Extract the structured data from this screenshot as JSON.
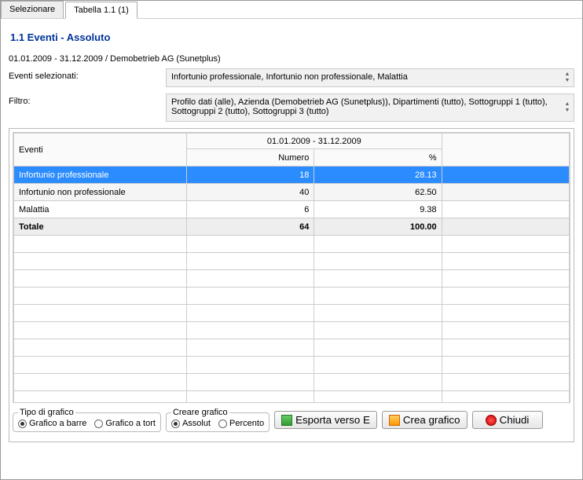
{
  "tabs": {
    "select": "Selezionare",
    "table": "Tabella 1.1 (1)"
  },
  "title": "1.1 Eventi - Assoluto",
  "date_range_company": "01.01.2009 - 31.12.2009 / Demobetrieb AG (Sunetplus)",
  "events_label": "Eventi selezionati:",
  "events_value": "Infortunio professionale, Infortunio non professionale, Malattia",
  "filter_label": "Filtro:",
  "filter_value": "Profilo dati (alle), Azienda (Demobetrieb AG (Sunetplus)), Dipartimenti (tutto), Sottogruppi 1 (tutto), Sottogruppi 2 (tutto), Sottogruppi 3 (tutto)",
  "table": {
    "header_events": "Eventi",
    "header_date_range": "01.01.2009 - 31.12.2009",
    "header_number": "Numero",
    "header_percent": "%",
    "rows": [
      {
        "label": "Infortunio professionale",
        "number": "18",
        "percent": "28.13"
      },
      {
        "label": "Infortunio non professionale",
        "number": "40",
        "percent": "62.50"
      },
      {
        "label": "Malattia",
        "number": "6",
        "percent": "9.38"
      }
    ],
    "total_label": "Totale",
    "total_number": "64",
    "total_percent": "100.00"
  },
  "chart_data": {
    "type": "table",
    "title": "1.1 Eventi - Assoluto",
    "date_range": "01.01.2009 - 31.12.2009",
    "categories": [
      "Infortunio professionale",
      "Infortunio non professionale",
      "Malattia"
    ],
    "series": [
      {
        "name": "Numero",
        "values": [
          18,
          40,
          6
        ]
      },
      {
        "name": "%",
        "values": [
          28.13,
          62.5,
          9.38
        ]
      }
    ],
    "total": {
      "Numero": 64,
      "%": 100.0
    }
  },
  "groupbox": {
    "chart_type_legend": "Tipo di grafico",
    "bar_chart": "Grafico a barre",
    "pie_chart": "Grafico a tort",
    "create_chart_legend": "Creare grafico",
    "absolute": "Assolut",
    "percent": "Percento"
  },
  "buttons": {
    "export": "Esporta verso E",
    "create_chart": "Crea grafico",
    "close": "Chiudi"
  }
}
